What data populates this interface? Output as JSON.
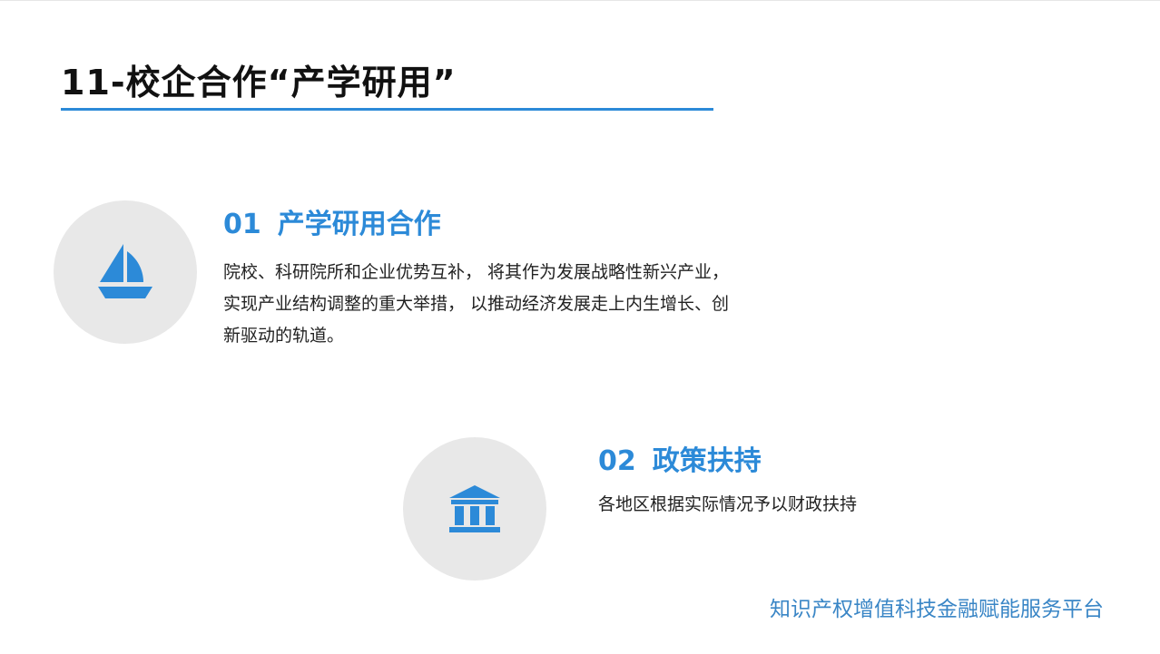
{
  "page": {
    "title": "11-校企合作“产学研用”"
  },
  "sections": [
    {
      "number": "01",
      "heading": "产学研用合作",
      "icon": "sailboat-icon",
      "body": "院校、科研院所和企业优势互补， 将其作为发展战略性新兴产业， 实现产业结构调整的重大举措， 以推动经济发展走上内生增长、创新驱动的轨道。"
    },
    {
      "number": "02",
      "heading": "政策扶持",
      "icon": "government-building-icon",
      "body": "各地区根据实际情况予以财政扶持"
    }
  ],
  "footer": {
    "brand": "知识产权增值科技金融赋能服务平台"
  },
  "colors": {
    "accent": "#2c8ad8",
    "circle_bg": "#e8e8e8",
    "text": "#222222",
    "footer": "#3a86c6"
  }
}
